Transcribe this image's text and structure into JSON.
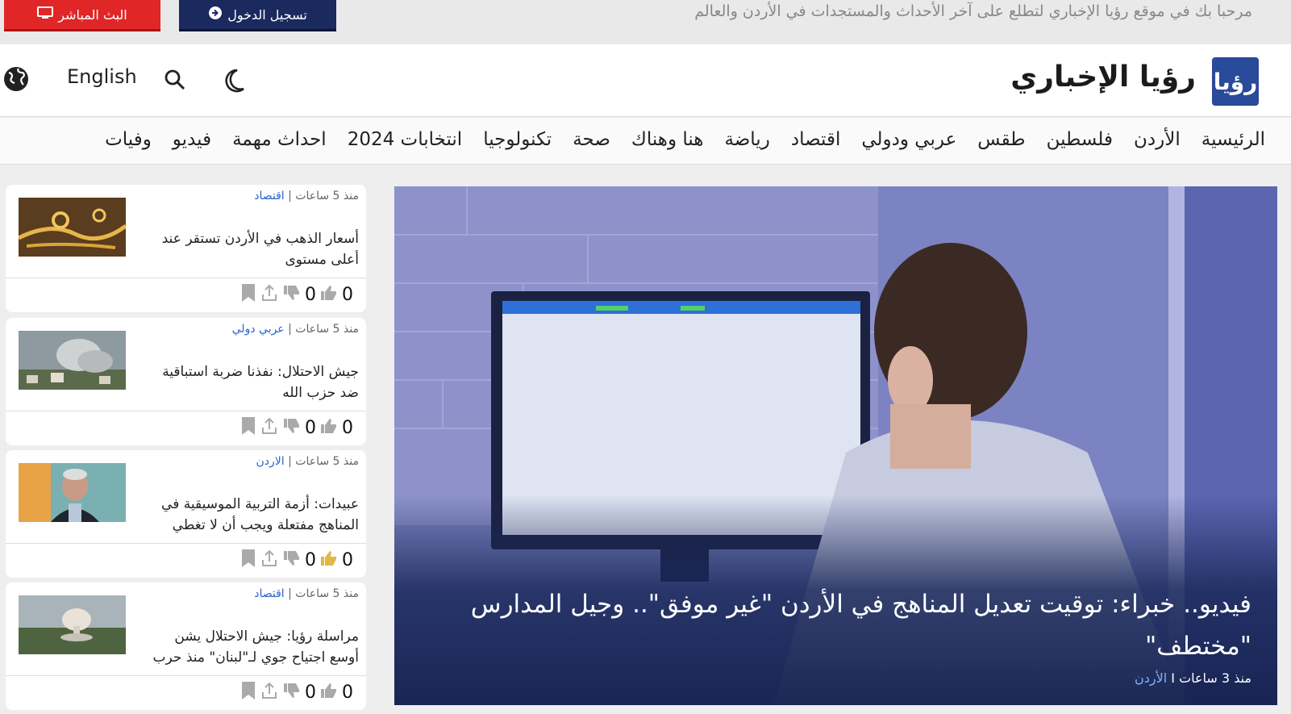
{
  "topbar": {
    "welcome": "مرحبا بك في موقع رؤيا الإخباري لتطلع على آخر الأحداث والمستجدات في الأردن والعالم",
    "live_label": "البث المباشر",
    "login_label": "تسجيل الدخول",
    "colors": {
      "live": "#e02626",
      "login": "#1a2a5e"
    }
  },
  "header": {
    "logo_text": "رؤيا",
    "brand": "رؤيا الإخباري",
    "english_label": "English",
    "icons": [
      "moon-icon",
      "search-icon",
      "globe-icon"
    ]
  },
  "nav": {
    "items": [
      "الرئيسية",
      "الأردن",
      "فلسطين",
      "طقس",
      "عربي ودولي",
      "اقتصاد",
      "رياضة",
      "هنا وهناك",
      "صحة",
      "تكنولوجيا",
      "انتخابات 2024",
      "احداث مهمة",
      "فيديو",
      "وفيات"
    ]
  },
  "hero": {
    "title": "فيديو.. خبراء: توقيت تعديل المناهج في الأردن \"غير موفق\".. وجيل المدارس \"مختطف\"",
    "time": "منذ 3 ساعات",
    "separator": "I",
    "category": "الأردن"
  },
  "cards": [
    {
      "time": "منذ 5 ساعات",
      "category": "اقتصاد",
      "title": "أسعار الذهب في الأردن تستقر عند أعلى مستوى",
      "likes": "0",
      "dislikes": "0",
      "thumb": "gold-jewelry"
    },
    {
      "time": "منذ 5 ساعات",
      "category": "عربي دولي",
      "title": "جيش الاحتلال: نفذنا ضربة استباقية ضد حزب الله",
      "likes": "0",
      "dislikes": "0",
      "thumb": "smoke-village"
    },
    {
      "time": "منذ 5 ساعات",
      "category": "الاردن",
      "title": "عبيدات: أزمة التربية الموسيقية في المناهج مفتعلة ويجب أن لا تغطي",
      "likes": "0",
      "dislikes": "0",
      "thumb": "man-portrait"
    },
    {
      "time": "منذ 5 ساعات",
      "category": "اقتصاد",
      "title": "مراسلة رؤيا: جيش الاحتلال يشن أوسع اجتياح جوي لـ\"لبنان\" منذ حرب",
      "likes": "0",
      "dislikes": "0",
      "thumb": "explosion-hills"
    }
  ],
  "card_separator": "|"
}
